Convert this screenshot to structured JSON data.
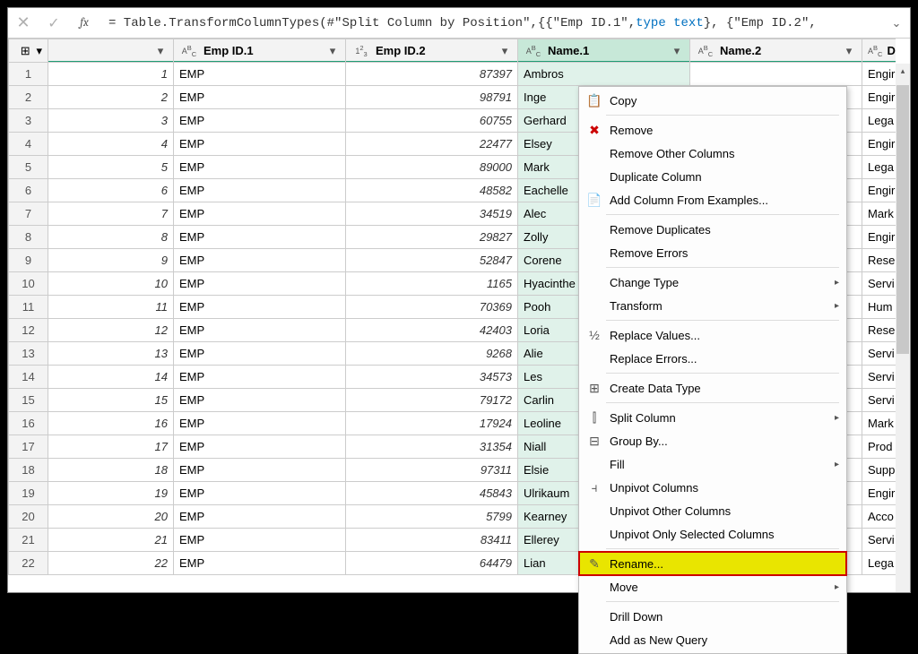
{
  "formula": {
    "prefix": "= Table.TransformColumnTypes(#\"Split Column by Position\",{{\"Emp ID.1\", ",
    "kw": "type text",
    "suffix": "}, {\"Emp ID.2\","
  },
  "columns": [
    {
      "label": "",
      "type_icon": ""
    },
    {
      "label": "Emp ID.1",
      "type_icon": "ABC"
    },
    {
      "label": "Emp ID.2",
      "type_icon": "123"
    },
    {
      "label": "Name.1",
      "type_icon": "ABC",
      "selected": true
    },
    {
      "label": "Name.2",
      "type_icon": "ABC"
    },
    {
      "label": "Dep",
      "type_icon": "ABC"
    }
  ],
  "rows": [
    {
      "n": 1,
      "c0": "1",
      "c1": "EMP",
      "c2": "87397",
      "c3": "Ambros",
      "c4": "",
      "c5": "Engir"
    },
    {
      "n": 2,
      "c0": "2",
      "c1": "EMP",
      "c2": "98791",
      "c3": "Inge",
      "c4": "",
      "c5": "Engir"
    },
    {
      "n": 3,
      "c0": "3",
      "c1": "EMP",
      "c2": "60755",
      "c3": "Gerhard",
      "c4": "",
      "c5": "Lega"
    },
    {
      "n": 4,
      "c0": "4",
      "c1": "EMP",
      "c2": "22477",
      "c3": "Elsey",
      "c4": "",
      "c5": "Engir"
    },
    {
      "n": 5,
      "c0": "5",
      "c1": "EMP",
      "c2": "89000",
      "c3": "Mark",
      "c4": "",
      "c5": "Lega"
    },
    {
      "n": 6,
      "c0": "6",
      "c1": "EMP",
      "c2": "48582",
      "c3": "Eachelle",
      "c4": "",
      "c5": "Engir"
    },
    {
      "n": 7,
      "c0": "7",
      "c1": "EMP",
      "c2": "34519",
      "c3": "Alec",
      "c4": "",
      "c5": "Mark"
    },
    {
      "n": 8,
      "c0": "8",
      "c1": "EMP",
      "c2": "29827",
      "c3": "Zolly",
      "c4": "",
      "c5": "Engir"
    },
    {
      "n": 9,
      "c0": "9",
      "c1": "EMP",
      "c2": "52847",
      "c3": "Corene",
      "c4": "",
      "c5": "Rese"
    },
    {
      "n": 10,
      "c0": "10",
      "c1": "EMP",
      "c2": "1165",
      "c3": "Hyacinthe",
      "c4": "",
      "c5": "Servi"
    },
    {
      "n": 11,
      "c0": "11",
      "c1": "EMP",
      "c2": "70369",
      "c3": "Pooh",
      "c4": "",
      "c5": "Hum"
    },
    {
      "n": 12,
      "c0": "12",
      "c1": "EMP",
      "c2": "42403",
      "c3": "Loria",
      "c4": "",
      "c5": "Rese"
    },
    {
      "n": 13,
      "c0": "13",
      "c1": "EMP",
      "c2": "9268",
      "c3": "Alie",
      "c4": "",
      "c5": "Servi"
    },
    {
      "n": 14,
      "c0": "14",
      "c1": "EMP",
      "c2": "34573",
      "c3": "Les",
      "c4": "",
      "c5": "Servi"
    },
    {
      "n": 15,
      "c0": "15",
      "c1": "EMP",
      "c2": "79172",
      "c3": "Carlin",
      "c4": "",
      "c5": "Servi"
    },
    {
      "n": 16,
      "c0": "16",
      "c1": "EMP",
      "c2": "17924",
      "c3": "Leoline",
      "c4": "",
      "c5": "Mark"
    },
    {
      "n": 17,
      "c0": "17",
      "c1": "EMP",
      "c2": "31354",
      "c3": "Niall",
      "c4": "",
      "c5": "Prod"
    },
    {
      "n": 18,
      "c0": "18",
      "c1": "EMP",
      "c2": "97311",
      "c3": "Elsie",
      "c4": "",
      "c5": "Supp"
    },
    {
      "n": 19,
      "c0": "19",
      "c1": "EMP",
      "c2": "45843",
      "c3": "Ulrikaum",
      "c4": "",
      "c5": "Engir"
    },
    {
      "n": 20,
      "c0": "20",
      "c1": "EMP",
      "c2": "5799",
      "c3": "Kearney",
      "c4": "",
      "c5": "Acco"
    },
    {
      "n": 21,
      "c0": "21",
      "c1": "EMP",
      "c2": "83411",
      "c3": "Ellerey",
      "c4": "",
      "c5": "Servi"
    },
    {
      "n": 22,
      "c0": "22",
      "c1": "EMP",
      "c2": "64479",
      "c3": "Lian",
      "c4": "",
      "c5": "Lega"
    }
  ],
  "menu": [
    {
      "icon": "📋",
      "label": "Copy",
      "sub": false
    },
    {
      "sep": true
    },
    {
      "icon": "✖",
      "label": "Remove",
      "sub": false,
      "iconColor": "#c00"
    },
    {
      "icon": "",
      "label": "Remove Other Columns",
      "sub": false
    },
    {
      "icon": "",
      "label": "Duplicate Column",
      "sub": false
    },
    {
      "icon": "📄",
      "label": "Add Column From Examples...",
      "sub": false
    },
    {
      "sep": true
    },
    {
      "icon": "",
      "label": "Remove Duplicates",
      "sub": false
    },
    {
      "icon": "",
      "label": "Remove Errors",
      "sub": false
    },
    {
      "sep": true
    },
    {
      "icon": "",
      "label": "Change Type",
      "sub": true
    },
    {
      "icon": "",
      "label": "Transform",
      "sub": true
    },
    {
      "sep": true
    },
    {
      "icon": "½",
      "label": "Replace Values...",
      "sub": false
    },
    {
      "icon": "",
      "label": "Replace Errors...",
      "sub": false
    },
    {
      "sep": true
    },
    {
      "icon": "⊞",
      "label": "Create Data Type",
      "sub": false
    },
    {
      "sep": true
    },
    {
      "icon": "⫿",
      "label": "Split Column",
      "sub": true
    },
    {
      "icon": "⊟",
      "label": "Group By...",
      "sub": false
    },
    {
      "icon": "",
      "label": "Fill",
      "sub": true
    },
    {
      "icon": "⫞",
      "label": "Unpivot Columns",
      "sub": false
    },
    {
      "icon": "",
      "label": "Unpivot Other Columns",
      "sub": false
    },
    {
      "icon": "",
      "label": "Unpivot Only Selected Columns",
      "sub": false
    },
    {
      "sep": true
    },
    {
      "icon": "✎",
      "label": "Rename...",
      "sub": false,
      "highlight": true
    },
    {
      "icon": "",
      "label": "Move",
      "sub": true
    },
    {
      "sep": true
    },
    {
      "icon": "",
      "label": "Drill Down",
      "sub": false
    },
    {
      "icon": "",
      "label": "Add as New Query",
      "sub": false
    }
  ],
  "icons": {
    "table": "⊞",
    "dd": "▾",
    "expand": "⌄",
    "sub": "▸",
    "up": "▴"
  }
}
